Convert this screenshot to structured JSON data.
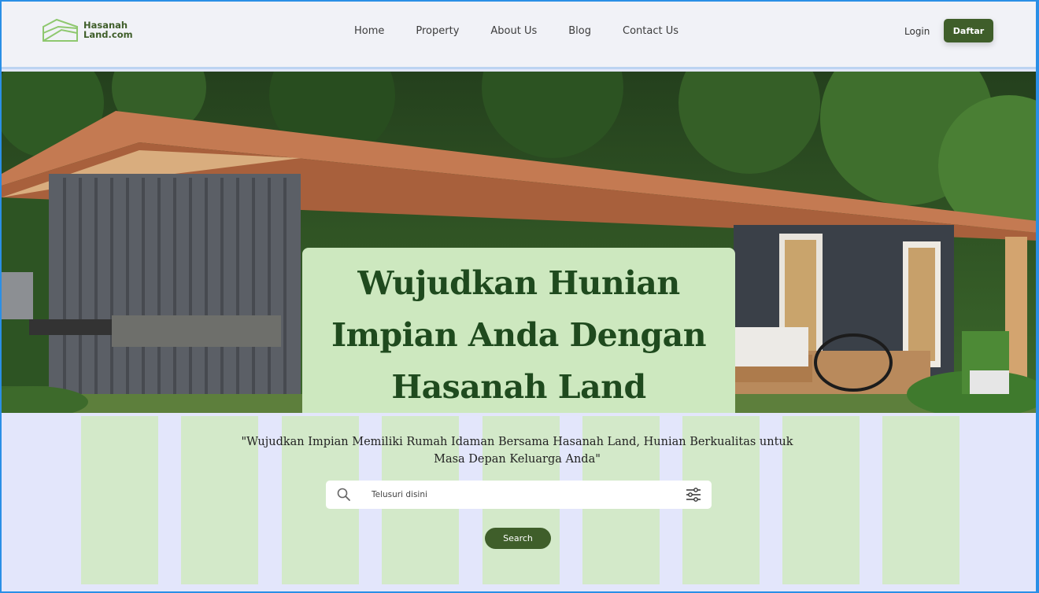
{
  "brand": {
    "line1": "Hasanah",
    "line2": "Land.com",
    "color": "#3f5e2a"
  },
  "nav": {
    "items": [
      {
        "label": "Home"
      },
      {
        "label": "Property"
      },
      {
        "label": "About Us"
      },
      {
        "label": "Blog"
      },
      {
        "label": "Contact Us"
      }
    ],
    "login_label": "Login",
    "signup_label": "Daftar"
  },
  "hero": {
    "headline": "Wujudkan Hunian Impian Anda Dengan Hasanah Land",
    "card_color": "#cde8bf"
  },
  "tagline": {
    "line1": "\"Wujudkan Impian Memiliki Rumah Idaman Bersama Hasanah Land, Hunian Berkualitas untuk",
    "line2": "Masa Depan Keluarga Anda\""
  },
  "search": {
    "placeholder": "Telusuri disini",
    "button_label": "Search"
  },
  "icons": {
    "search": "search-icon",
    "filter": "filter-sliders-icon",
    "logo": "house-logo-icon"
  },
  "colors": {
    "accent": "#3f5e2a",
    "background": "#e3e6fb",
    "column": "#d3e9c9"
  }
}
